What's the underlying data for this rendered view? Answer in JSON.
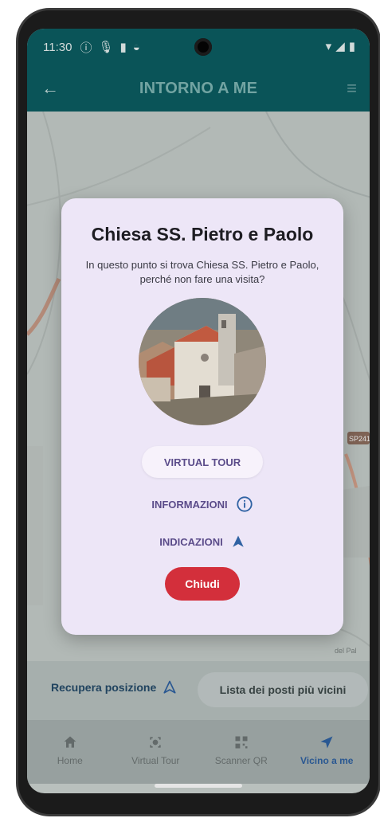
{
  "status_bar": {
    "time": "11:30"
  },
  "app_bar": {
    "title": "INTORNO A ME"
  },
  "map": {
    "road_label": "SP241",
    "road_label_2": "del Pal"
  },
  "dialog": {
    "title": "Chiesa SS. Pietro e Paolo",
    "message": "In questo punto si trova Chiesa SS. Pietro e Paolo, perché non fare una visita?",
    "virtual_tour_label": "VIRTUAL TOUR",
    "informazioni_label": "INFORMAZIONI",
    "indicazioni_label": "INDICAZIONI",
    "close_label": "Chiudi"
  },
  "bottom_controls": {
    "recupera_label": "Recupera posizione",
    "lista_label": "Lista dei posti più vicini"
  },
  "bottom_nav": {
    "items": [
      {
        "label": "Home",
        "icon": "home-icon"
      },
      {
        "label": "Virtual Tour",
        "icon": "virtual-tour-icon"
      },
      {
        "label": "Scanner QR",
        "icon": "qr-icon"
      },
      {
        "label": "Vicino a me",
        "icon": "navigation-icon"
      }
    ],
    "active_index": 3
  },
  "colors": {
    "app_bar": "#0c5e63",
    "dialog_bg": "#ede6f7",
    "accent": "#5b4c8a",
    "close_button": "#d32f3b",
    "nav_active": "#2f62a3"
  }
}
